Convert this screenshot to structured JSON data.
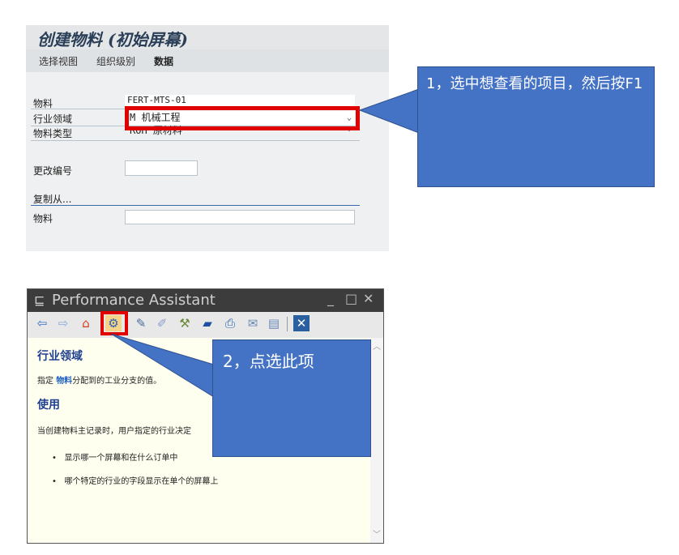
{
  "sap": {
    "title": "创建物料 (初始屏幕)",
    "menu": [
      "选择视图",
      "组织级别",
      "数据"
    ],
    "fields": {
      "material_label": "物料",
      "material_value": "FERT-MTS-01",
      "industry_label": "行业领域",
      "industry_value": "M 机械工程",
      "material_type_label": "物料类型",
      "material_type_value": "ROH 原材料",
      "change_number_label": "更改编号",
      "copy_from_label": "复制从...",
      "copy_material_label": "物料"
    }
  },
  "callout1": {
    "text": "1，选中想查看的项目，然后按F1"
  },
  "performance_assistant": {
    "title": "Performance Assistant",
    "heading1": "行业领域",
    "desc_prefix": "指定 ",
    "desc_link": "物料",
    "desc_suffix": "分配到的工业分支的值。",
    "heading2": "使用",
    "usage_text": "当创建物料主记录时，用户指定的行业决定",
    "bullet1": "显示哪一个屏幕和在什么订单中",
    "bullet2": "哪个特定的行业的字段显示在单个的屏幕上",
    "toolbar_icons": [
      "back-icon",
      "forward-icon",
      "home-icon",
      "technical-info-icon",
      "edit-icon",
      "pen-icon",
      "tools-icon",
      "flag-icon",
      "print-icon",
      "mail-icon",
      "notes-icon",
      "close-icon"
    ]
  },
  "callout2": {
    "text": "2，点选此项"
  },
  "colors": {
    "accent": "#4472c4",
    "highlight": "#e00000",
    "link": "#1f5fbf"
  }
}
